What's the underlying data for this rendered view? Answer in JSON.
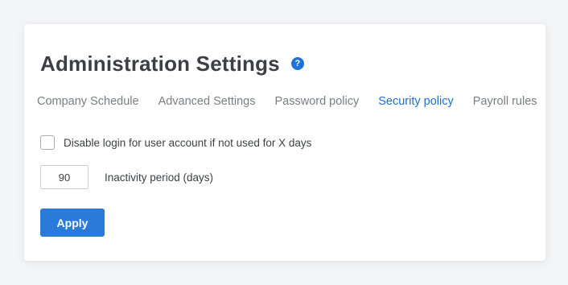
{
  "header": {
    "title": "Administration Settings",
    "help_icon": "question-mark-icon",
    "help_glyph": "?"
  },
  "tabs": [
    {
      "label": "Company Schedule",
      "active": false
    },
    {
      "label": "Advanced Settings",
      "active": false
    },
    {
      "label": "Password policy",
      "active": false
    },
    {
      "label": "Security policy",
      "active": true
    },
    {
      "label": "Payroll rules",
      "active": false
    }
  ],
  "security": {
    "disable_login_label": "Disable login for user account if not used for X days",
    "disable_login_checked": false,
    "inactivity_value": "90",
    "inactivity_label": "Inactivity period (days)"
  },
  "actions": {
    "apply_label": "Apply"
  },
  "colors": {
    "accent": "#2a7bd9",
    "active_tab": "#1f6fc9",
    "text": "#3d3f44",
    "muted": "#7a7d83"
  }
}
